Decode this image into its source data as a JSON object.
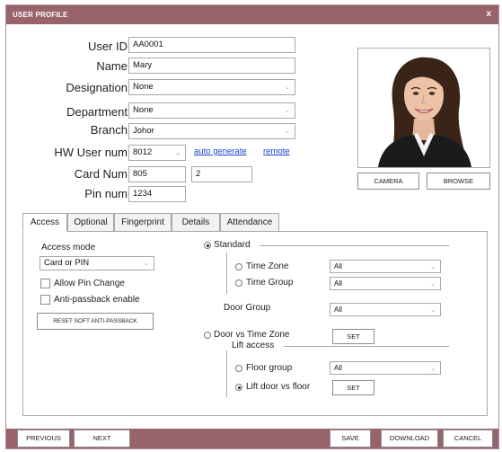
{
  "window": {
    "title": "USER PROFILE",
    "close_label": "x"
  },
  "form": {
    "user_id": {
      "label": "User ID",
      "value": "AA0001"
    },
    "name": {
      "label": "Name",
      "value": "Mary"
    },
    "designation": {
      "label": "Designation",
      "value": "None"
    },
    "department": {
      "label": "Department",
      "value": "None"
    },
    "branch": {
      "label": "Branch",
      "value": "Johor"
    },
    "hw_user_num": {
      "label": "HW User num",
      "value": "8012",
      "auto_generate": "auto generate",
      "remote": "remote"
    },
    "card_num": {
      "label": "Card Num",
      "value": "805",
      "value2": "2"
    },
    "pin_num": {
      "label": "Pin num",
      "value": "1234"
    }
  },
  "photo": {
    "camera_label": "CAMERA",
    "browse_label": "BROWSE"
  },
  "tabs": [
    "Access",
    "Optional",
    "Fingerprint",
    "Details",
    "Attendance"
  ],
  "access": {
    "access_mode_label": "Access mode",
    "access_mode_value": "Card or PIN",
    "allow_pin_change": "Allow Pin Change",
    "anti_passback": "Anti-passback enable",
    "reset_button": "RESET SOFT ANTI-PASSBACK",
    "standard": "Standard",
    "time_zone": "Time Zone",
    "time_zone_value": "All",
    "time_group": "Time Group",
    "time_group_value": "All",
    "door_group": "Door Group",
    "door_group_value": "All",
    "door_vs_time_zone": "Door vs Time Zone",
    "set1": "SET",
    "lift_access": "Lift access",
    "floor_group": "Floor group",
    "floor_group_value": "All",
    "lift_door_vs_floor": "Lift door vs floor",
    "set2": "SET"
  },
  "footer": {
    "previous": "PREVIOUS",
    "next": "NEXT",
    "save": "SAVE",
    "download": "DOWNLOAD",
    "cancel": "CANCEL"
  },
  "icons": {
    "dropdown": "chevron-down-icon"
  },
  "colors": {
    "titlebar": "#99636c",
    "link": "#1a3fcf"
  }
}
